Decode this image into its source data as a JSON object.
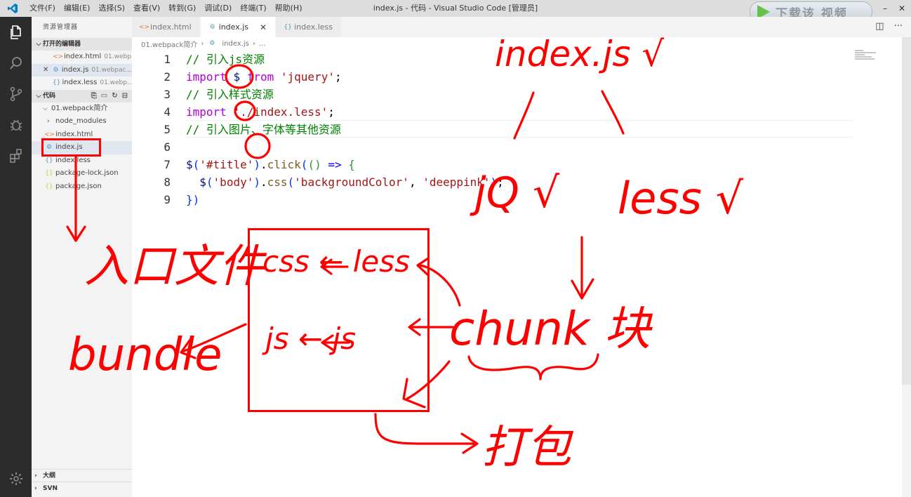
{
  "app": {
    "window_title": "index.js - 代码 - Visual Studio Code [管理员]",
    "menu": [
      "文件(F)",
      "编辑(E)",
      "选择(S)",
      "查看(V)",
      "转到(G)",
      "调试(D)",
      "终端(T)",
      "帮助(H)"
    ],
    "watermark": "下载该 视频"
  },
  "sidebar": {
    "title": "资源管理器",
    "open_editors": {
      "label": "打开的编辑器",
      "items": [
        {
          "name": "index.html",
          "path": "01.webp...",
          "icon": "html-file-icon"
        },
        {
          "name": "index.js",
          "path": "01.webpac...",
          "icon": "js-file-icon"
        },
        {
          "name": "index.less",
          "path": "01.webp...",
          "icon": "less-file-icon"
        }
      ]
    },
    "workspace": {
      "label": "代码",
      "folder": "01.webpack简介",
      "items": [
        {
          "name": "node_modules",
          "icon": "folder-icon"
        },
        {
          "name": "index.html",
          "icon": "html-file-icon"
        },
        {
          "name": "index.js",
          "icon": "js-file-icon"
        },
        {
          "name": "index.less",
          "icon": "less-file-icon"
        },
        {
          "name": "package-lock.json",
          "icon": "json-file-icon"
        },
        {
          "name": "package.json",
          "icon": "json-file-icon"
        }
      ]
    },
    "outline_label": "大纲",
    "svn_label": "SVN"
  },
  "tabs": [
    {
      "label": "index.html",
      "active": false
    },
    {
      "label": "index.js",
      "active": true
    },
    {
      "label": "index.less",
      "active": false
    }
  ],
  "breadcrumb": [
    "01.webpack简介",
    "index.js",
    "..."
  ],
  "editor": {
    "line_numbers": [
      "1",
      "2",
      "3",
      "4",
      "5",
      "6",
      "7",
      "8",
      "9"
    ],
    "lines": [
      "// 引入js资源",
      "import $ from 'jquery';",
      "// 引入样式资源",
      "import './index.less';",
      "// 引入图片、字体等其他资源",
      "",
      "$('#title').click(() => {",
      "  $('body').css('backgroundColor', 'deeppink');",
      "})"
    ]
  },
  "annotations": {
    "index_js": "index.js √",
    "jq": "jQ √",
    "less": "less √",
    "entry": "入口文件",
    "bundle": "bundle",
    "css_from_less": "css ← less",
    "js_from_js": "js ← js",
    "chunk": "chunk 块",
    "pack": "打包"
  },
  "colors": {
    "ink": "#ff0000",
    "comment": "#008000",
    "keyword": "#af00db",
    "string": "#a31515",
    "activity_bar": "#2c2c2c"
  }
}
